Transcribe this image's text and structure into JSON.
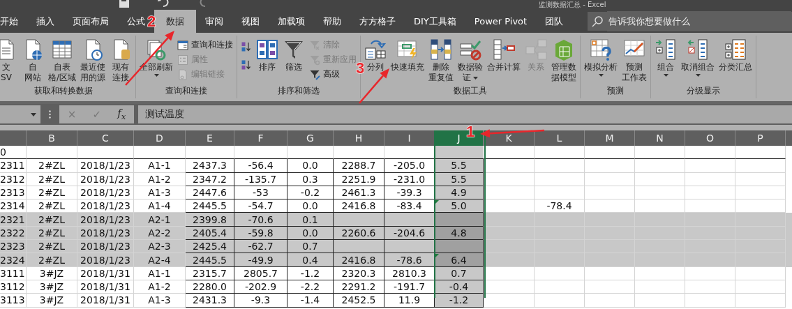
{
  "window": {
    "title": "监测数据汇总 - Excel"
  },
  "tabs": [
    {
      "label": "开始",
      "selected": false
    },
    {
      "label": "插入",
      "selected": false
    },
    {
      "label": "页面布局",
      "selected": false
    },
    {
      "label": "公式",
      "selected": false
    },
    {
      "label": "数据",
      "selected": true
    },
    {
      "label": "审阅",
      "selected": false
    },
    {
      "label": "视图",
      "selected": false
    },
    {
      "label": "加载项",
      "selected": false
    },
    {
      "label": "帮助",
      "selected": false
    },
    {
      "label": "方方格子",
      "selected": false
    },
    {
      "label": "DIY工具箱",
      "selected": false
    },
    {
      "label": "Power Pivot",
      "selected": false
    },
    {
      "label": "团队",
      "selected": false
    }
  ],
  "search": {
    "placeholder": "告诉我你想要做什么"
  },
  "ribbon_groups": [
    {
      "label": "获取和转换数据",
      "items": [
        {
          "kind": "large",
          "lines": [
            "文",
            "SV"
          ],
          "disabled": false,
          "dropdown": false
        },
        {
          "kind": "large",
          "lines": [
            "自",
            "网站"
          ],
          "disabled": false,
          "dropdown": false
        },
        {
          "kind": "large",
          "lines": [
            "自表",
            "格/区域"
          ],
          "disabled": false,
          "dropdown": false
        },
        {
          "kind": "large",
          "lines": [
            "最近使",
            "用的源"
          ],
          "disabled": false,
          "dropdown": false
        },
        {
          "kind": "large",
          "lines": [
            "现有",
            "连接"
          ],
          "disabled": false,
          "dropdown": false
        }
      ]
    },
    {
      "label": "查询和连接",
      "items": [
        {
          "kind": "large",
          "lines": [
            "全部刷新"
          ],
          "disabled": false,
          "dropdown": true
        },
        {
          "kind": "small",
          "lines": [
            "查询和连接"
          ],
          "disabled": false
        },
        {
          "kind": "small",
          "lines": [
            "属性"
          ],
          "disabled": true
        },
        {
          "kind": "small",
          "lines": [
            "编辑链接"
          ],
          "disabled": true
        }
      ]
    },
    {
      "label": "排序和筛选",
      "items": [
        {
          "kind": "icon"
        },
        {
          "kind": "icon"
        },
        {
          "kind": "large",
          "lines": [
            "排序"
          ],
          "disabled": false,
          "dropdown": false
        },
        {
          "kind": "large",
          "lines": [
            "筛选"
          ],
          "disabled": false,
          "dropdown": false
        },
        {
          "kind": "small",
          "lines": [
            "清除"
          ],
          "disabled": true
        },
        {
          "kind": "small",
          "lines": [
            "重新应用"
          ],
          "disabled": true
        },
        {
          "kind": "small",
          "lines": [
            "高级"
          ],
          "disabled": false
        }
      ]
    },
    {
      "label": "数据工具",
      "items": [
        {
          "kind": "large",
          "lines": [
            "分列"
          ],
          "disabled": false,
          "dropdown": false
        },
        {
          "kind": "large",
          "lines": [
            "快速填充"
          ],
          "disabled": false,
          "dropdown": false
        },
        {
          "kind": "large",
          "lines": [
            "删除",
            "重复值"
          ],
          "disabled": false,
          "dropdown": false
        },
        {
          "kind": "large",
          "lines": [
            "数据验",
            "证"
          ],
          "disabled": false,
          "dropdown": true
        },
        {
          "kind": "large",
          "lines": [
            "合并计算"
          ],
          "disabled": false,
          "dropdown": false
        },
        {
          "kind": "large",
          "lines": [
            "关系"
          ],
          "disabled": true,
          "dropdown": false
        },
        {
          "kind": "large",
          "lines": [
            "管理数",
            "据模型"
          ],
          "disabled": false,
          "dropdown": false
        }
      ]
    },
    {
      "label": "预测",
      "items": [
        {
          "kind": "large",
          "lines": [
            "模拟分析"
          ],
          "disabled": false,
          "dropdown": true
        },
        {
          "kind": "large",
          "lines": [
            "预测",
            "工作表"
          ],
          "disabled": false,
          "dropdown": false
        }
      ]
    },
    {
      "label": "分级显示",
      "items": [
        {
          "kind": "large",
          "lines": [
            "组合"
          ],
          "disabled": false,
          "dropdown": true
        },
        {
          "kind": "large",
          "lines": [
            "取消组合"
          ],
          "disabled": false,
          "dropdown": true
        },
        {
          "kind": "large",
          "lines": [
            "分类汇总"
          ],
          "disabled": false,
          "dropdown": false
        }
      ]
    }
  ],
  "formula_bar": {
    "cancel": "×",
    "enter": "✓",
    "function": "f$_{x}$",
    "value": "测试温度"
  },
  "columns": [
    {
      "selected": false
    },
    {
      "label": "B",
      "selected": false
    },
    {
      "label": "C",
      "selected": false
    },
    {
      "label": "D",
      "selected": false
    },
    {
      "label": "E",
      "selected": false
    },
    {
      "label": "F",
      "selected": false
    },
    {
      "label": "G",
      "selected": false
    },
    {
      "label": "H",
      "selected": false
    },
    {
      "label": "I",
      "selected": false
    },
    {
      "label": "J",
      "selected": true
    },
    {
      "label": "K",
      "selected": false
    },
    {
      "label": "L",
      "selected": false
    },
    {
      "label": "M",
      "selected": false
    },
    {
      "label": "N",
      "selected": false
    },
    {
      "label": "O",
      "selected": false
    },
    {
      "label": "P",
      "selected": false
    }
  ],
  "rows": [
    {
      "highlighted": false,
      "flagged": false,
      "cells": {
        "A": "0"
      }
    },
    {
      "highlighted": false,
      "flagged": false,
      "cells": {
        "A": "2311",
        "B": "2#ZL",
        "C": "2018/1/23",
        "D": "A1-1",
        "E": "2437.3",
        "F": "-56.4",
        "G": "0.0",
        "H": "2288.7",
        "I": "-205.0",
        "J": "5.5"
      }
    },
    {
      "highlighted": false,
      "flagged": false,
      "cells": {
        "A": "2312",
        "B": "2#ZL",
        "C": "2018/1/23",
        "D": "A1-2",
        "E": "2347.2",
        "F": "-135.7",
        "G": "0.3",
        "H": "2251.9",
        "I": "-231.0",
        "J": "5.5"
      }
    },
    {
      "highlighted": false,
      "flagged": false,
      "cells": {
        "A": "2313",
        "B": "2#ZL",
        "C": "2018/1/23",
        "D": "A1-3",
        "E": "2447.6",
        "F": "-53",
        "G": "-0.2",
        "H": "2461.3",
        "I": "-39.3",
        "J": "4.9"
      }
    },
    {
      "highlighted": false,
      "flagged": true,
      "cells": {
        "A": "2314",
        "B": "2#ZL",
        "C": "2018/1/23",
        "D": "A1-4",
        "E": "2445.5",
        "F": "-54.7",
        "G": "0.0",
        "H": "2416.8",
        "I": "-83.4",
        "J": "5.0",
        "L": "-78.4"
      }
    },
    {
      "highlighted": true,
      "flagged": false,
      "cells": {
        "A": "2321",
        "B": "2#ZL",
        "C": "2018/1/23",
        "D": "A2-1",
        "E": "2399.8",
        "F": "-70.6",
        "G": "0.1"
      }
    },
    {
      "highlighted": true,
      "flagged": false,
      "cells": {
        "A": "2322",
        "B": "2#ZL",
        "C": "2018/1/23",
        "D": "A2-2",
        "E": "2405.4",
        "F": "-59.8",
        "G": "0.0",
        "H": "2260.6",
        "I": "-204.6",
        "J": "4.8"
      }
    },
    {
      "highlighted": true,
      "flagged": false,
      "cells": {
        "A": "2323",
        "B": "2#ZL",
        "C": "2018/1/23",
        "D": "A2-3",
        "E": "2425.4",
        "F": "-62.7",
        "G": "0.7"
      }
    },
    {
      "highlighted": true,
      "flagged": true,
      "cells": {
        "A": "2324",
        "B": "2#ZL",
        "C": "2018/1/23",
        "D": "A2-4",
        "E": "2445.5",
        "F": "-49.9",
        "G": "0.4",
        "H": "2416.8",
        "I": "-78.6",
        "J": "6.4"
      }
    },
    {
      "highlighted": false,
      "flagged": false,
      "cells": {
        "A": "3111",
        "B": "3#JZ",
        "C": "2018/1/31",
        "D": "A1-1",
        "E": "2315.7",
        "F": "2805.7",
        "G": "-1.2",
        "H": "2320.3",
        "I": "2810.3",
        "J": "0.7"
      }
    },
    {
      "highlighted": false,
      "flagged": false,
      "cells": {
        "A": "3112",
        "B": "3#JZ",
        "C": "2018/1/31",
        "D": "A1-2",
        "E": "2280.0",
        "F": "-202.9",
        "G": "-2.2",
        "H": "2291.2",
        "I": "-191.7",
        "J": "-0.4"
      }
    },
    {
      "highlighted": false,
      "flagged": false,
      "cells": {
        "A": "3113",
        "B": "3#JZ",
        "C": "2018/1/31",
        "D": "A1-3",
        "E": "2431.3",
        "F": "-9.3",
        "G": "-1.4",
        "H": "2452.5",
        "I": "11.9",
        "J": "-1.2"
      }
    }
  ],
  "annotations": [
    {
      "label": "2"
    },
    {
      "label": "3"
    },
    {
      "label": "1"
    }
  ]
}
